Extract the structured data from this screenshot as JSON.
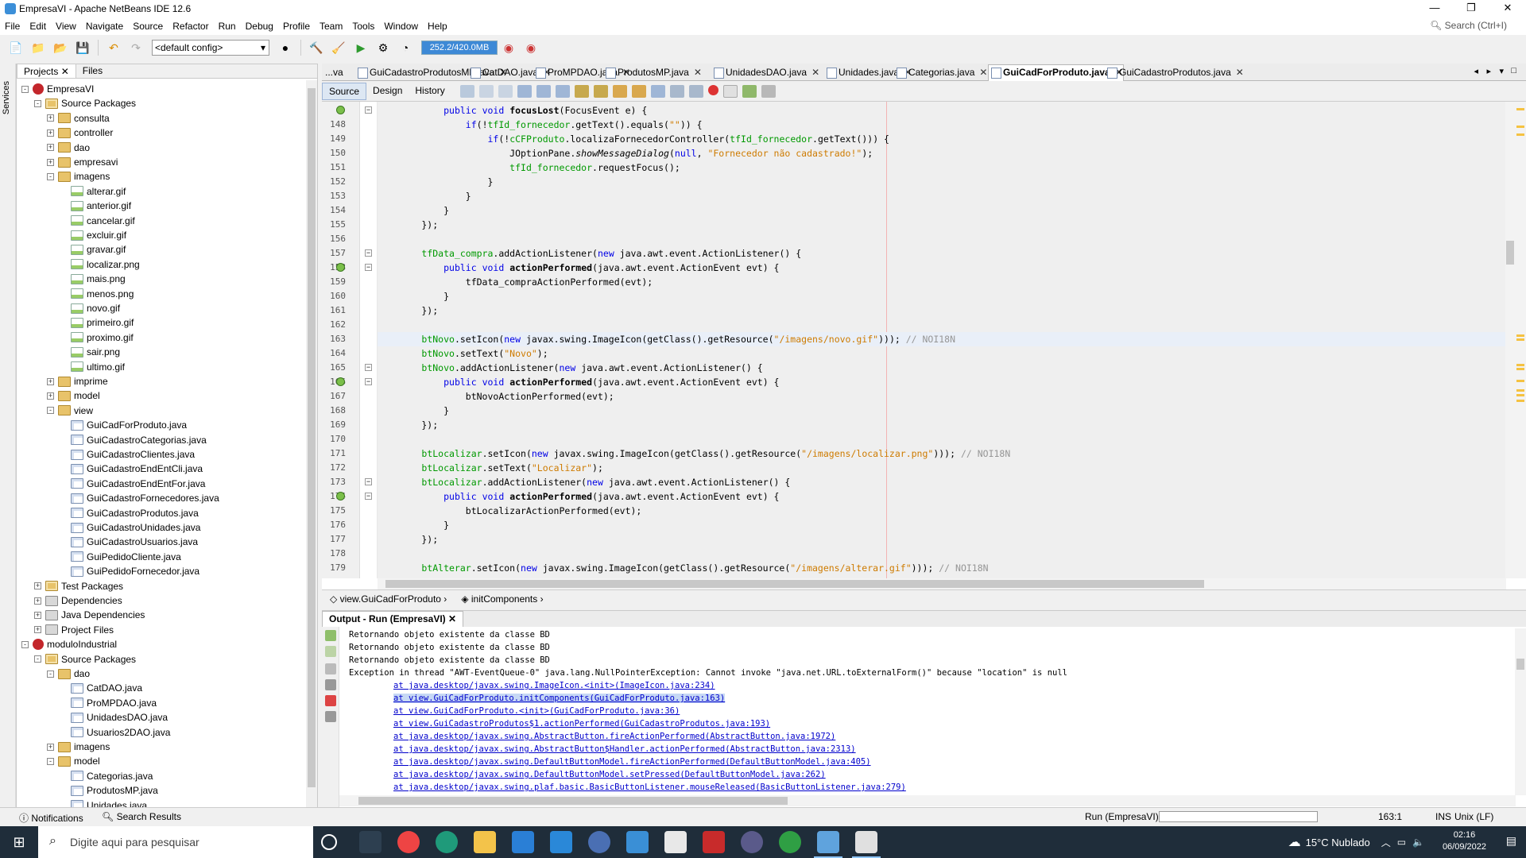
{
  "window": {
    "title": "EmpresaVI - Apache NetBeans IDE 12.6"
  },
  "menu": {
    "items": [
      "File",
      "Edit",
      "View",
      "Navigate",
      "Source",
      "Refactor",
      "Run",
      "Debug",
      "Profile",
      "Team",
      "Tools",
      "Window",
      "Help"
    ],
    "search_placeholder": "Search (Ctrl+I)"
  },
  "toolbar": {
    "config": "<default config>",
    "memory": "252.2/420.0MB"
  },
  "leftstrip": {
    "label": "Services"
  },
  "projects": {
    "tabs": [
      "Projects",
      "Files"
    ],
    "tree": [
      {
        "label": "EmpresaVI",
        "level": 0,
        "type": "proj",
        "exp": "-"
      },
      {
        "label": "Source Packages",
        "level": 1,
        "type": "src",
        "exp": "-"
      },
      {
        "label": "consulta",
        "level": 2,
        "type": "pkg",
        "exp": "+"
      },
      {
        "label": "controller",
        "level": 2,
        "type": "pkg",
        "exp": "+"
      },
      {
        "label": "dao",
        "level": 2,
        "type": "pkg",
        "exp": "+"
      },
      {
        "label": "empresavi",
        "level": 2,
        "type": "pkg",
        "exp": "+"
      },
      {
        "label": "imagens",
        "level": 2,
        "type": "pkg",
        "exp": "-"
      },
      {
        "label": "alterar.gif",
        "level": 3,
        "type": "img"
      },
      {
        "label": "anterior.gif",
        "level": 3,
        "type": "img"
      },
      {
        "label": "cancelar.gif",
        "level": 3,
        "type": "img"
      },
      {
        "label": "excluir.gif",
        "level": 3,
        "type": "img"
      },
      {
        "label": "gravar.gif",
        "level": 3,
        "type": "img"
      },
      {
        "label": "localizar.png",
        "level": 3,
        "type": "img"
      },
      {
        "label": "mais.png",
        "level": 3,
        "type": "img"
      },
      {
        "label": "menos.png",
        "level": 3,
        "type": "img"
      },
      {
        "label": "novo.gif",
        "level": 3,
        "type": "img"
      },
      {
        "label": "primeiro.gif",
        "level": 3,
        "type": "img"
      },
      {
        "label": "proximo.gif",
        "level": 3,
        "type": "img"
      },
      {
        "label": "sair.png",
        "level": 3,
        "type": "img"
      },
      {
        "label": "ultimo.gif",
        "level": 3,
        "type": "img"
      },
      {
        "label": "imprime",
        "level": 2,
        "type": "pkg",
        "exp": "+"
      },
      {
        "label": "model",
        "level": 2,
        "type": "pkg",
        "exp": "+"
      },
      {
        "label": "view",
        "level": 2,
        "type": "pkg",
        "exp": "-"
      },
      {
        "label": "GuiCadForProduto.java",
        "level": 3,
        "type": "java"
      },
      {
        "label": "GuiCadastroCategorias.java",
        "level": 3,
        "type": "java"
      },
      {
        "label": "GuiCadastroClientes.java",
        "level": 3,
        "type": "java"
      },
      {
        "label": "GuiCadastroEndEntCli.java",
        "level": 3,
        "type": "java"
      },
      {
        "label": "GuiCadastroEndEntFor.java",
        "level": 3,
        "type": "java"
      },
      {
        "label": "GuiCadastroFornecedores.java",
        "level": 3,
        "type": "java"
      },
      {
        "label": "GuiCadastroProdutos.java",
        "level": 3,
        "type": "java"
      },
      {
        "label": "GuiCadastroUnidades.java",
        "level": 3,
        "type": "java"
      },
      {
        "label": "GuiCadastroUsuarios.java",
        "level": 3,
        "type": "java"
      },
      {
        "label": "GuiPedidoCliente.java",
        "level": 3,
        "type": "java"
      },
      {
        "label": "GuiPedidoFornecedor.java",
        "level": 3,
        "type": "java"
      },
      {
        "label": "Test Packages",
        "level": 1,
        "type": "src",
        "exp": "+"
      },
      {
        "label": "Dependencies",
        "level": 1,
        "type": "lib",
        "exp": "+"
      },
      {
        "label": "Java Dependencies",
        "level": 1,
        "type": "lib",
        "exp": "+"
      },
      {
        "label": "Project Files",
        "level": 1,
        "type": "lib",
        "exp": "+"
      },
      {
        "label": "moduloIndustrial",
        "level": 0,
        "type": "proj",
        "exp": "-"
      },
      {
        "label": "Source Packages",
        "level": 1,
        "type": "src",
        "exp": "-"
      },
      {
        "label": "dao",
        "level": 2,
        "type": "pkg",
        "exp": "-"
      },
      {
        "label": "CatDAO.java",
        "level": 3,
        "type": "java"
      },
      {
        "label": "ProMPDAO.java",
        "level": 3,
        "type": "java"
      },
      {
        "label": "UnidadesDAO.java",
        "level": 3,
        "type": "java"
      },
      {
        "label": "Usuarios2DAO.java",
        "level": 3,
        "type": "java"
      },
      {
        "label": "imagens",
        "level": 2,
        "type": "pkg",
        "exp": "+"
      },
      {
        "label": "model",
        "level": 2,
        "type": "pkg",
        "exp": "-"
      },
      {
        "label": "Categorias.java",
        "level": 3,
        "type": "java"
      },
      {
        "label": "ProdutosMP.java",
        "level": 3,
        "type": "java"
      },
      {
        "label": "Unidades.java",
        "level": 3,
        "type": "java"
      },
      {
        "label": "Usuarios2.java",
        "level": 3,
        "type": "java"
      }
    ]
  },
  "editor": {
    "tabs": [
      {
        "label": "...va",
        "active": false,
        "nox": true
      },
      {
        "label": "GuiCadastroProdutosMP.java",
        "active": false
      },
      {
        "label": "CatDAO.java",
        "active": false
      },
      {
        "label": "ProMPDAO.java",
        "active": false
      },
      {
        "label": "ProdutosMP.java",
        "active": false
      },
      {
        "label": "UnidadesDAO.java",
        "active": false
      },
      {
        "label": "Unidades.java",
        "active": false
      },
      {
        "label": "Categorias.java",
        "active": false
      },
      {
        "label": "GuiCadForProduto.java",
        "active": true
      },
      {
        "label": "GuiCadastroProdutos.java",
        "active": false
      }
    ],
    "views": [
      "Source",
      "Design",
      "History"
    ],
    "lines": [
      {
        "n": "",
        "t": "            <span class=\"kw\">public</span> <span class=\"kw\">void</span> <span class=\"mth\">focusLost</span>(FocusEvent e) {"
      },
      {
        "n": "148",
        "t": "                <span class=\"kw\">if</span>(!<span class=\"fld\">tfId_fornecedor</span>.getText().equals(<span class=\"str\">\"\"</span>)) {"
      },
      {
        "n": "149",
        "t": "                    <span class=\"kw\">if</span>(!<span class=\"fld\">cCFProduto</span>.localizaFornecedorController(<span class=\"fld\">tfId_fornecedor</span>.getText())) {"
      },
      {
        "n": "150",
        "t": "                        JOptionPane.<span class=\"ital\">showMessageDialog</span>(<span class=\"kw\">null</span>, <span class=\"str\">\"Fornecedor não cadastrado!\"</span>);"
      },
      {
        "n": "151",
        "t": "                        <span class=\"fld\">tfId_fornecedor</span>.requestFocus();"
      },
      {
        "n": "152",
        "t": "                    }"
      },
      {
        "n": "153",
        "t": "                }"
      },
      {
        "n": "154",
        "t": "            }"
      },
      {
        "n": "155",
        "t": "        });"
      },
      {
        "n": "156",
        "t": ""
      },
      {
        "n": "157",
        "t": "        <span class=\"fld\">tfData_compra</span>.addActionListener(<span class=\"kw\">new</span> java.awt.event.ActionListener() {"
      },
      {
        "n": "158",
        "t": "            <span class=\"kw\">public</span> <span class=\"kw\">void</span> <span class=\"mth\">actionPerformed</span>(java.awt.event.ActionEvent evt) {"
      },
      {
        "n": "159",
        "t": "                tfData_compraActionPerformed(evt);"
      },
      {
        "n": "160",
        "t": "            }"
      },
      {
        "n": "161",
        "t": "        });"
      },
      {
        "n": "162",
        "t": ""
      },
      {
        "n": "163",
        "t": "        <span class=\"fld\">btNovo</span>.setIcon(<span class=\"kw\">new</span> javax.swing.ImageIcon(getClass().getResource(<span class=\"str\">\"/imagens/novo.gif\"</span>))); <span class=\"cmt\">// NOI18N</span>",
        "cur": true
      },
      {
        "n": "164",
        "t": "        <span class=\"fld\">btNovo</span>.setText(<span class=\"str\">\"Novo\"</span>);"
      },
      {
        "n": "165",
        "t": "        <span class=\"fld\">btNovo</span>.addActionListener(<span class=\"kw\">new</span> java.awt.event.ActionListener() {"
      },
      {
        "n": "166",
        "t": "            <span class=\"kw\">public</span> <span class=\"kw\">void</span> <span class=\"mth\">actionPerformed</span>(java.awt.event.ActionEvent evt) {"
      },
      {
        "n": "167",
        "t": "                btNovoActionPerformed(evt);"
      },
      {
        "n": "168",
        "t": "            }"
      },
      {
        "n": "169",
        "t": "        });"
      },
      {
        "n": "170",
        "t": ""
      },
      {
        "n": "171",
        "t": "        <span class=\"fld\">btLocalizar</span>.setIcon(<span class=\"kw\">new</span> javax.swing.ImageIcon(getClass().getResource(<span class=\"str\">\"/imagens/localizar.png\"</span>))); <span class=\"cmt\">// NOI18N</span>"
      },
      {
        "n": "172",
        "t": "        <span class=\"fld\">btLocalizar</span>.setText(<span class=\"str\">\"Localizar\"</span>);"
      },
      {
        "n": "173",
        "t": "        <span class=\"fld\">btLocalizar</span>.addActionListener(<span class=\"kw\">new</span> java.awt.event.ActionListener() {"
      },
      {
        "n": "174",
        "t": "            <span class=\"kw\">public</span> <span class=\"kw\">void</span> <span class=\"mth\">actionPerformed</span>(java.awt.event.ActionEvent evt) {"
      },
      {
        "n": "175",
        "t": "                btLocalizarActionPerformed(evt);"
      },
      {
        "n": "176",
        "t": "            }"
      },
      {
        "n": "177",
        "t": "        });"
      },
      {
        "n": "178",
        "t": ""
      },
      {
        "n": "179",
        "t": "        <span class=\"fld\">btAlterar</span>.setIcon(<span class=\"kw\">new</span> javax.swing.ImageIcon(getClass().getResource(<span class=\"str\">\"/imagens/alterar.gif\"</span>))); <span class=\"cmt\">// NOI18N</span>"
      }
    ],
    "breadcrumbs": [
      "view.GuiCadForProduto",
      "initComponents"
    ]
  },
  "output": {
    "tab": "Output - Run (EmpresaVI)",
    "lines": [
      {
        "t": "Retornando objeto existente da classe BD",
        "link": false
      },
      {
        "t": "Retornando objeto existente da classe BD",
        "link": false
      },
      {
        "t": "Retornando objeto existente da classe BD",
        "link": false
      },
      {
        "t": "Exception in thread \"AWT-EventQueue-0\" java.lang.NullPointerException: Cannot invoke \"java.net.URL.toExternalForm()\" because \"location\" is null",
        "link": false
      },
      {
        "t": "at java.desktop/javax.swing.ImageIcon.<init>(ImageIcon.java:234)",
        "link": true
      },
      {
        "t": "at view.GuiCadForProduto.initComponents(GuiCadForProduto.java:163)",
        "link": true,
        "sel": true
      },
      {
        "t": "at view.GuiCadForProduto.<init>(GuiCadForProduto.java:36)",
        "link": true
      },
      {
        "t": "at view.GuiCadastroProdutos$1.actionPerformed(GuiCadastroProdutos.java:193)",
        "link": true
      },
      {
        "t": "at java.desktop/javax.swing.AbstractButton.fireActionPerformed(AbstractButton.java:1972)",
        "link": true
      },
      {
        "t": "at java.desktop/javax.swing.AbstractButton$Handler.actionPerformed(AbstractButton.java:2313)",
        "link": true
      },
      {
        "t": "at java.desktop/javax.swing.DefaultButtonModel.fireActionPerformed(DefaultButtonModel.java:405)",
        "link": true
      },
      {
        "t": "at java.desktop/javax.swing.DefaultButtonModel.setPressed(DefaultButtonModel.java:262)",
        "link": true
      },
      {
        "t": "at java.desktop/javax.swing.plaf.basic.BasicButtonListener.mouseReleased(BasicButtonListener.java:279)",
        "link": true
      }
    ]
  },
  "status": {
    "notifications": "Notifications",
    "search_results": "Search Results",
    "run": "Run (EmpresaVI)",
    "position": "163:1",
    "mode": "INS",
    "eol": "Unix (LF)"
  },
  "taskbar": {
    "search_placeholder": "Digite aqui para pesquisar",
    "weather": "15°C  Nublado",
    "time": "02:16",
    "date": "06/09/2022"
  }
}
